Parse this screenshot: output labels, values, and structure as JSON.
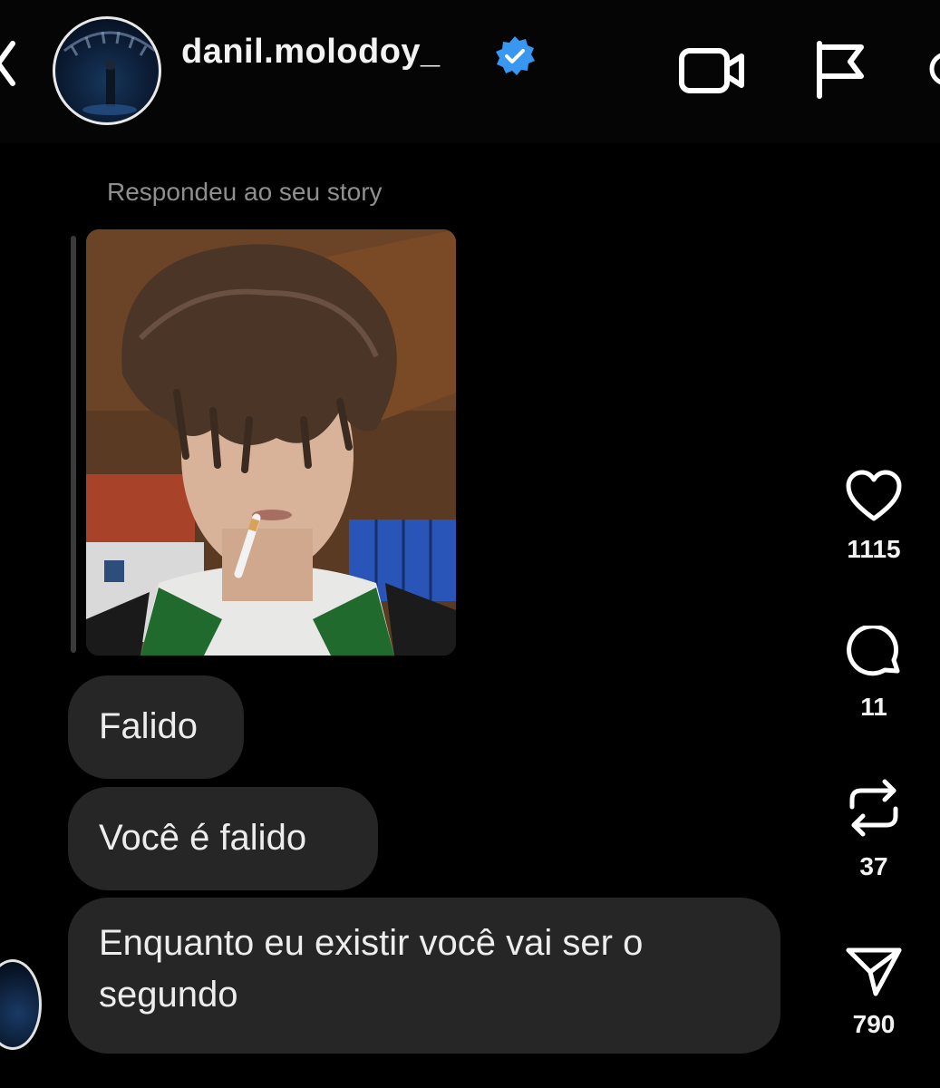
{
  "header": {
    "username": "danil.molodoy_",
    "verified": true,
    "icons": [
      "back-icon",
      "avatar",
      "verified-icon",
      "video-call-icon",
      "flag-icon",
      "info-icon"
    ]
  },
  "chat": {
    "reply_label": "Respondeu ao seu story",
    "messages": [
      {
        "text": "Falido"
      },
      {
        "text": "Você é falido"
      },
      {
        "text": "Enquanto eu existir você vai ser o segundo"
      }
    ]
  },
  "actions": {
    "like": {
      "icon": "heart-icon",
      "count": "1115"
    },
    "comment": {
      "icon": "comment-icon",
      "count": "11"
    },
    "repost": {
      "icon": "repost-icon",
      "count": "37"
    },
    "share": {
      "icon": "send-icon",
      "count": "790"
    }
  },
  "colors": {
    "background": "#000000",
    "bubble": "#262626",
    "verified_badge": "#3897f0",
    "muted_text": "#8f8f8f"
  }
}
